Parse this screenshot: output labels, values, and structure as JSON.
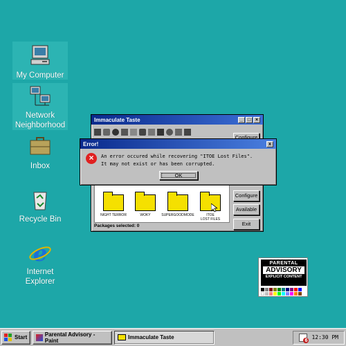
{
  "desktop": {
    "icons": [
      {
        "label_line1": "My Computer",
        "label_line2": ""
      },
      {
        "label_line1": "Network",
        "label_line2": "Neighborhood"
      },
      {
        "label_line1": "Inbox",
        "label_line2": ""
      },
      {
        "label_line1": "Recycle Bin",
        "label_line2": ""
      },
      {
        "label_line1": "Internet",
        "label_line2": "Explorer"
      }
    ]
  },
  "main_window": {
    "title": "Immaculate Taste",
    "side_buttons": [
      "Configure",
      "Configure",
      "Available",
      "Exit"
    ],
    "folders": [
      {
        "label1": "NIGHT TERROR",
        "label2": ""
      },
      {
        "label1": "WOKY",
        "label2": ""
      },
      {
        "label1": "SUPERGOODMODE",
        "label2": ""
      },
      {
        "label1": "ITOE",
        "label2": "LOST FILES"
      }
    ],
    "status": "Packages selected: 0"
  },
  "error_dialog": {
    "title": "Error!",
    "close": "x",
    "message_line1": "An error occured while recovering \"ITOE Lost Files\".",
    "message_line2": "It may not exist or has been corrupted.",
    "ok_label": "OK"
  },
  "album": {
    "line1": "PARENTAL",
    "line2": "ADVISORY",
    "line3": "EXPLICIT CONTENT"
  },
  "taskbar": {
    "start_label": "Start",
    "tasks": [
      {
        "label": "Parental Advisory - Paint",
        "active": false
      },
      {
        "label": "Immaculate Taste",
        "active": true
      }
    ],
    "tray_badge": "6",
    "clock": "12:30 PM"
  },
  "colors": {
    "desktop": "#1da7a8",
    "titlebar": "#0a2a8c",
    "folder": "#f5e000",
    "error_icon": "#e02020"
  }
}
